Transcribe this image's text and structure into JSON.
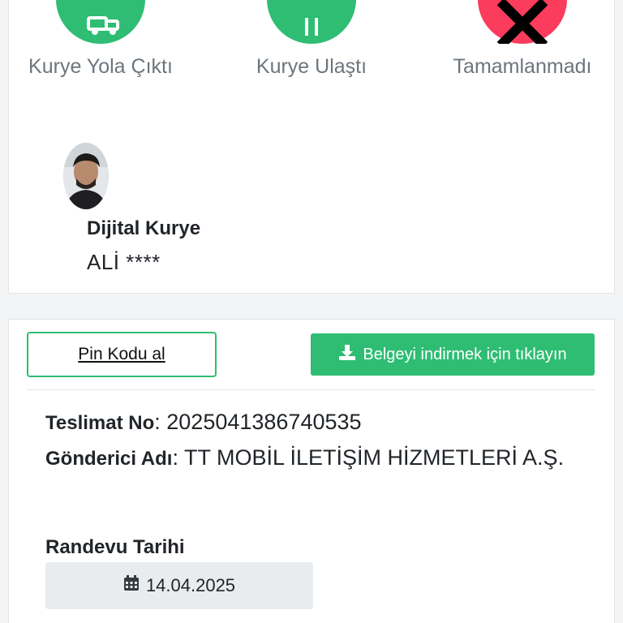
{
  "status_steps": [
    {
      "label": "Kurye Yola Çıktı",
      "icon": "truck-icon",
      "color": "#2ebd73"
    },
    {
      "label": "Kurye Ulaştı",
      "icon": "location-icon",
      "color": "#2ebd73"
    },
    {
      "label": "Tamamlanmadı",
      "icon": "close-icon",
      "color": "#fb3c5c"
    }
  ],
  "courier": {
    "title": "Dijital Kurye",
    "name": "ALİ ****"
  },
  "actions": {
    "pin_label": "Pin Kodu al",
    "download_label": "Belgeyi indirmek için tıklayın"
  },
  "delivery": {
    "no_label": "Teslimat No",
    "no_value": "2025041386740535",
    "sender_label": "Gönderici Adı",
    "sender_value": "TT MOBİL İLETİŞİM HİZMETLERİ A.Ş."
  },
  "appointment": {
    "label": "Randevu Tarihi",
    "date": "14.04.2025"
  }
}
